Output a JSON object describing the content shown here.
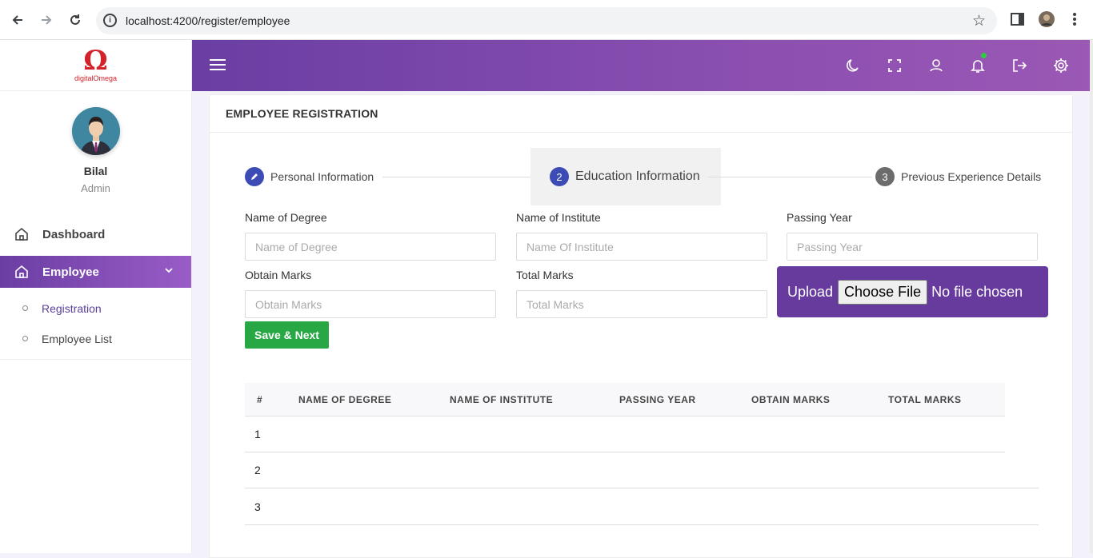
{
  "browser": {
    "url": "localhost:4200/register/employee",
    "back_icon": "back-arrow-icon",
    "forward_icon": "forward-arrow-icon",
    "reload_icon": "reload-icon",
    "info_glyph": "i"
  },
  "sidebar": {
    "logo_text": "digitalOmega",
    "logo_glyph": "Ω",
    "user_name": "Bilal",
    "user_role": "Admin",
    "menu": [
      {
        "label": "Dashboard",
        "icon": "home-icon"
      },
      {
        "label": "Employee",
        "icon": "home-icon",
        "active": true
      }
    ],
    "submenu": [
      {
        "label": "Registration",
        "active": true
      },
      {
        "label": "Employee List"
      }
    ]
  },
  "topbar": {
    "icons": [
      "menu-icon",
      "moon-icon",
      "fullscreen-icon",
      "user-icon",
      "bell-icon",
      "logout-icon",
      "settings-icon"
    ]
  },
  "card": {
    "title": "EMPLOYEE REGISTRATION"
  },
  "stepper": {
    "steps": [
      {
        "number": "",
        "label": "Personal Information",
        "state": "done"
      },
      {
        "number": "2",
        "label": "Education Information",
        "state": "active"
      },
      {
        "number": "3",
        "label": "Previous Experience Details",
        "state": "pending"
      }
    ]
  },
  "form": {
    "degree_label": "Name of Degree",
    "degree_placeholder": "Name of Degree",
    "institute_label": "Name of Institute",
    "institute_placeholder": "Name Of Institute",
    "year_label": "Passing Year",
    "year_placeholder": "Passing Year",
    "obtain_label": "Obtain Marks",
    "obtain_placeholder": "Obtain Marks",
    "total_label": "Total Marks",
    "total_placeholder": "Total Marks",
    "upload_label": "Upload",
    "choose_file": "Choose File",
    "no_file": "No file chosen",
    "save_button": "Save & Next"
  },
  "table": {
    "headers": [
      "#",
      "NAME OF DEGREE",
      "NAME OF INSTITUTE",
      "PASSING YEAR",
      "OBTAIN MARKS",
      "TOTAL MARKS"
    ],
    "rows": [
      "1",
      "2",
      "3"
    ]
  },
  "colors": {
    "primary": "#6a3ea3",
    "success": "#28a745",
    "step_done": "#3d4bb5",
    "step_pending": "#6c6c6c",
    "logo": "#d3222a"
  }
}
